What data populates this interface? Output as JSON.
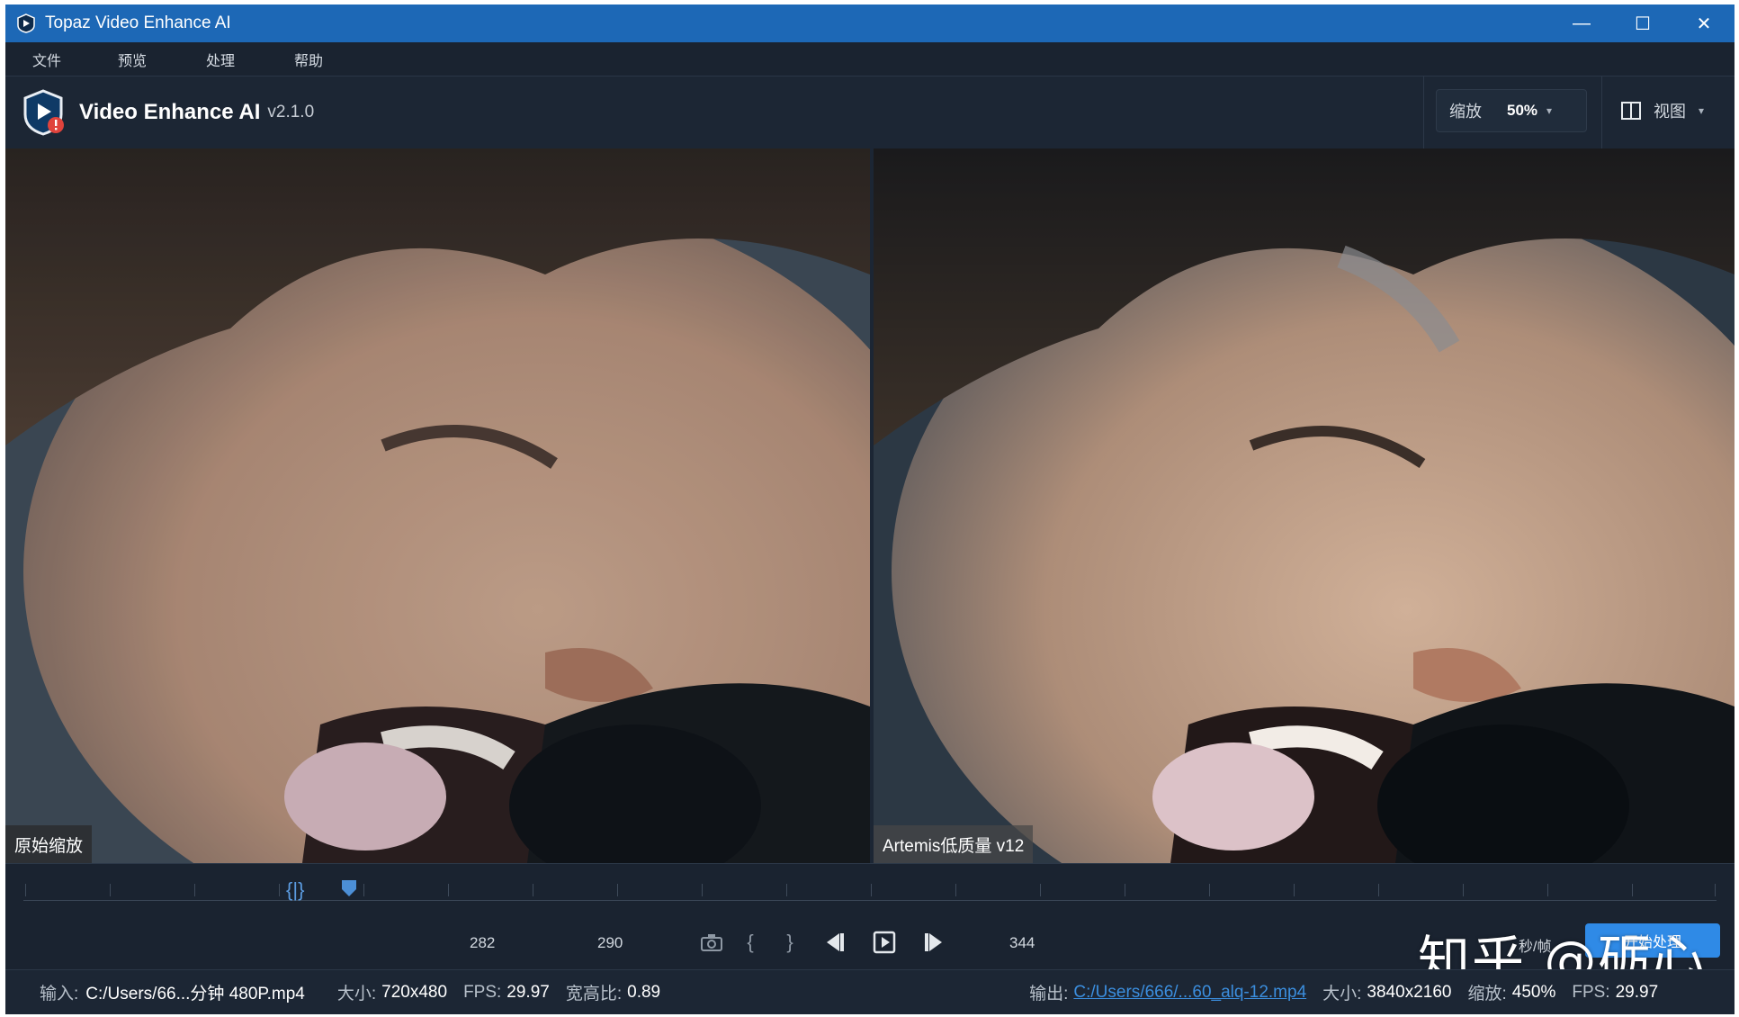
{
  "window": {
    "title": "Topaz Video Enhance AI",
    "controls": {
      "minimize": "—",
      "maximize": "☐",
      "close": "✕"
    }
  },
  "menu": {
    "items": [
      "文件",
      "预览",
      "处理",
      "帮助"
    ]
  },
  "header": {
    "brand": "Video Enhance AI",
    "version": "v2.1.0",
    "zoom_label": "缩放",
    "zoom_value": "50%",
    "view_label": "视图"
  },
  "panes": {
    "left_label": "原始缩放",
    "right_label": "Artemis低质量 v12"
  },
  "timeline": {
    "in_frame": "282",
    "current_frame": "290",
    "out_frame": "344",
    "fps_unit": "秒/帧",
    "export_label": "开始处理"
  },
  "watermark": "知乎 @砺心",
  "status": {
    "input_label": "输入:",
    "input_path": "C:/Users/66...分钟 480P.mp4",
    "input_size_label": "大小:",
    "input_size": "720x480",
    "input_fps_label": "FPS:",
    "input_fps": "29.97",
    "aspect_label": "宽高比:",
    "aspect": "0.89",
    "output_label": "输出:",
    "output_path": "C:/Users/666/...60_alq-12.mp4",
    "output_size_label": "大小:",
    "output_size": "3840x2160",
    "output_zoom_label": "缩放:",
    "output_zoom": "450%",
    "output_fps_label": "FPS:",
    "output_fps": "29.97"
  },
  "colors": {
    "titlebar": "#1d68b6",
    "app_bg": "#1c2634",
    "accent": "#2f8ae6"
  }
}
